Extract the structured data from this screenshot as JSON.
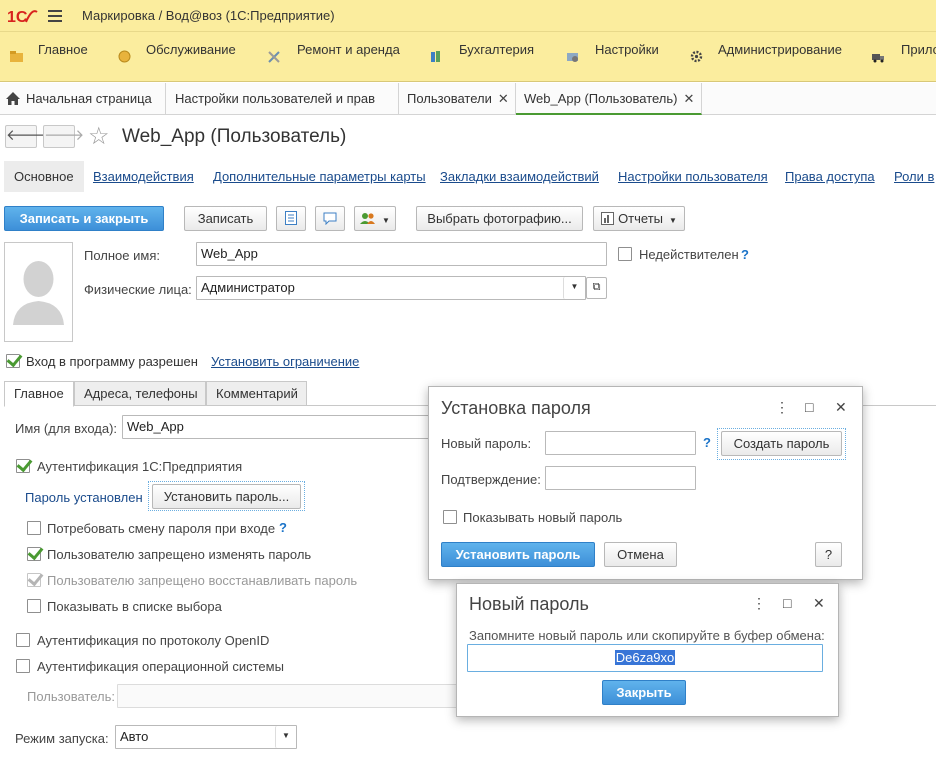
{
  "app": {
    "title": "Маркировка / Вод@воз  (1С:Предприятие)",
    "logo_text": "1С"
  },
  "sections": [
    {
      "label": "Главное",
      "icon": "folder-icon"
    },
    {
      "label": "Обслуживание",
      "icon": "coin-icon"
    },
    {
      "label": "Ремонт и аренда",
      "icon": "tools-icon"
    },
    {
      "label": "Бухгалтерия",
      "icon": "books-icon"
    },
    {
      "label": "Настройки",
      "icon": "settings-icon"
    },
    {
      "label": "Администрирование",
      "icon": "gear-icon"
    },
    {
      "label": "Прило",
      "icon": "truck-icon"
    }
  ],
  "open_tabs": [
    {
      "label": "Начальная страница"
    },
    {
      "label": "Настройки пользователей и прав"
    },
    {
      "label": "Пользователи"
    },
    {
      "label": "Web_App (Пользователь)"
    }
  ],
  "form": {
    "title": "Web_App (Пользователь)",
    "links": [
      "Основное",
      "Взаимодействия",
      "Дополнительные параметры карты",
      "Закладки взаимодействий",
      "Настройки пользователя",
      "Права доступа",
      "Роли в"
    ],
    "toolbar": {
      "save_close": "Записать и закрыть",
      "save": "Записать",
      "choose_photo": "Выбрать фотографию...",
      "reports": "Отчеты"
    },
    "full_name_label": "Полное имя:",
    "full_name_value": "Web_App",
    "invalid_label": "Недействителен",
    "invalid_help": "?",
    "person_label": "Физические лица:",
    "person_value": "Администратор",
    "login_allowed_label": "Вход в программу разрешен",
    "set_restriction_link": "Установить ограничение"
  },
  "page_tabs": [
    "Главное",
    "Адреса, телефоны",
    "Комментарий"
  ],
  "main_tab": {
    "login_name_label": "Имя (для входа):",
    "login_name_value": "Web_App",
    "auth_1c_label": "Аутентификация 1С:Предприятия",
    "password_set_link": "Пароль установлен",
    "set_password_button": "Установить пароль...",
    "require_change_label": "Потребовать смену пароля при входе",
    "require_change_help": "?",
    "deny_change_label": "Пользователю запрещено изменять пароль",
    "deny_restore_label": "Пользователю запрещено восстанавливать пароль",
    "show_in_list_label": "Показывать в списке выбора",
    "openid_label": "Аутентификация по протоколу OpenID",
    "os_auth_label": "Аутентификация операционной системы",
    "os_user_label": "Пользователь:",
    "os_user_value": "",
    "launch_mode_label": "Режим запуска:",
    "launch_mode_value": "Авто"
  },
  "password_dialog": {
    "title": "Установка пароля",
    "new_password_label": "Новый пароль:",
    "new_password_value": "",
    "help": "?",
    "create_password_button": "Создать пароль",
    "confirm_label": "Подтверждение:",
    "confirm_value": "",
    "show_new_password_label": "Показывать новый пароль",
    "set_button": "Установить пароль",
    "cancel_button": "Отмена",
    "help_button": "?",
    "more_icon": "⋮",
    "maximize_icon": "□",
    "close_icon": "✕"
  },
  "new_password_dialog": {
    "title": "Новый пароль",
    "message": "Запомните новый пароль или скопируйте в буфер обмена:",
    "password_value": "De6za9xo",
    "close_button": "Закрыть",
    "more_icon": "⋮",
    "maximize_icon": "□",
    "close_icon": "✕"
  },
  "colors": {
    "header_bg": "#fbed9e",
    "primary": "#3d8fd8",
    "link": "#1a4b8c",
    "check": "#4a9a32",
    "logo_red": "#d8231e"
  }
}
